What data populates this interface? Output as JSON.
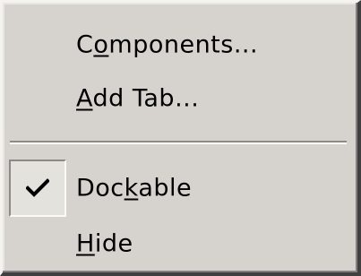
{
  "menu": {
    "items": [
      {
        "prefix": "C",
        "accel": "o",
        "suffix": "mponents...",
        "checked": false
      },
      {
        "prefix": "",
        "accel": "A",
        "suffix": "dd Tab...",
        "checked": false
      },
      {
        "prefix": "Doc",
        "accel": "k",
        "suffix": "able",
        "checked": true
      },
      {
        "prefix": "",
        "accel": "H",
        "suffix": "ide",
        "checked": false
      }
    ]
  },
  "icons": {
    "check": "check-icon"
  },
  "colors": {
    "menu_face": "#d6d3ce",
    "highlight": "#f4f3f0",
    "shadow": "#808080",
    "dark_shadow": "#404040",
    "text": "#000000"
  }
}
